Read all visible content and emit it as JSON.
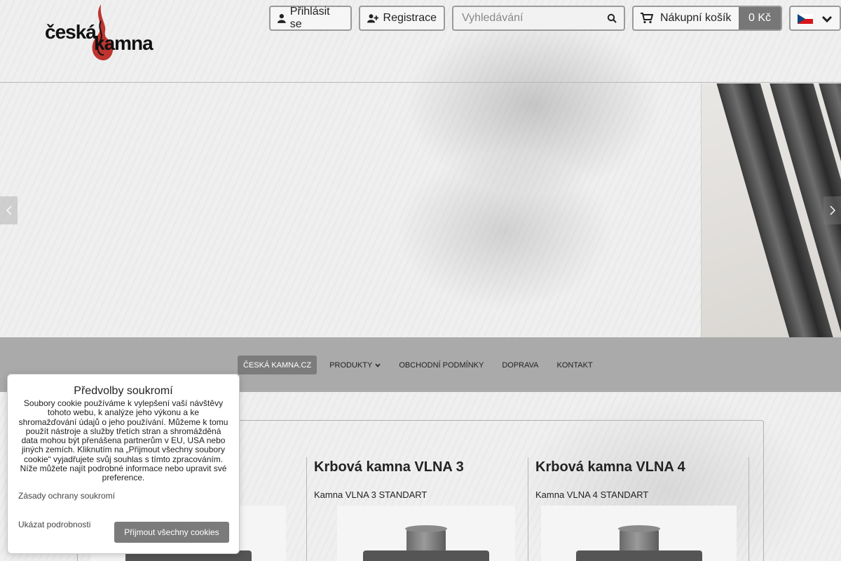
{
  "brand": {
    "logo_word1": "česká",
    "logo_word2": "kamna",
    "flame_color": "#b8201a"
  },
  "header": {
    "login_label": "Přihlásit se",
    "register_label": "Registrace",
    "search_placeholder": "Vyhledávání",
    "cart_label": "Nákupní košík",
    "cart_total": "0 Kč",
    "language": "cs"
  },
  "nav": {
    "items": [
      {
        "label": "ČESKÁ KAMNA.CZ",
        "active": true
      },
      {
        "label": "PRODUKTY",
        "has_dropdown": true
      },
      {
        "label": "OBCHODNÍ PODMÍNKY"
      },
      {
        "label": "DOPRAVA"
      },
      {
        "label": "KONTAKT"
      }
    ]
  },
  "products": [
    {
      "title": "",
      "subtitle": ""
    },
    {
      "title": "Krbová kamna VLNA 3",
      "subtitle": "Kamna VLNA 3 STANDART"
    },
    {
      "title": "Krbová kamna VLNA 4",
      "subtitle": "Kamna VLNA 4 STANDART"
    }
  ],
  "cookie": {
    "title": "Předvolby soukromí",
    "text": "Soubory cookie používáme k vylepšení vaší návštěvy tohoto webu, k analýze jeho výkonu a ke shromažďování údajů o jeho používání. Můžeme k tomu použít nástroje a služby třetích stran a shromážděná data mohou být přenášena partnerům v EU, USA nebo jiných zemích. Kliknutím na „Přijmout všechny soubory cookie“ vyjadřujete svůj souhlas s tímto zpracováním. Níže můžete najít podrobné informace nebo upravit své preference.",
    "privacy_link": "Zásady ochrany soukromí",
    "details_link": "Ukázat podrobnosti",
    "accept_label": "Přijmout všechny cookies"
  },
  "colors": {
    "nav_bg": "#a9aaa9",
    "nav_active": "#7c7c7c",
    "cart_price_bg": "#777777"
  }
}
